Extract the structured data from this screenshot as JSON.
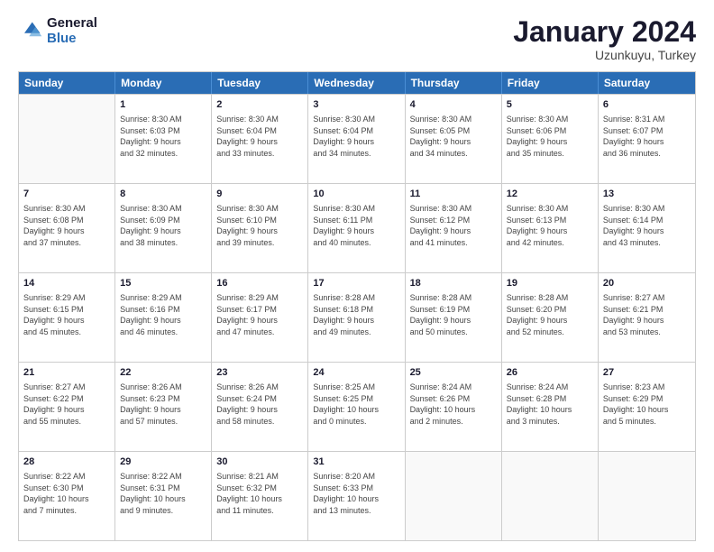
{
  "logo": {
    "general": "General",
    "blue": "Blue"
  },
  "header": {
    "month": "January 2024",
    "location": "Uzunkuyu, Turkey"
  },
  "weekdays": [
    "Sunday",
    "Monday",
    "Tuesday",
    "Wednesday",
    "Thursday",
    "Friday",
    "Saturday"
  ],
  "weeks": [
    [
      {
        "day": "",
        "info": ""
      },
      {
        "day": "1",
        "info": "Sunrise: 8:30 AM\nSunset: 6:03 PM\nDaylight: 9 hours\nand 32 minutes."
      },
      {
        "day": "2",
        "info": "Sunrise: 8:30 AM\nSunset: 6:04 PM\nDaylight: 9 hours\nand 33 minutes."
      },
      {
        "day": "3",
        "info": "Sunrise: 8:30 AM\nSunset: 6:04 PM\nDaylight: 9 hours\nand 34 minutes."
      },
      {
        "day": "4",
        "info": "Sunrise: 8:30 AM\nSunset: 6:05 PM\nDaylight: 9 hours\nand 34 minutes."
      },
      {
        "day": "5",
        "info": "Sunrise: 8:30 AM\nSunset: 6:06 PM\nDaylight: 9 hours\nand 35 minutes."
      },
      {
        "day": "6",
        "info": "Sunrise: 8:31 AM\nSunset: 6:07 PM\nDaylight: 9 hours\nand 36 minutes."
      }
    ],
    [
      {
        "day": "7",
        "info": ""
      },
      {
        "day": "8",
        "info": "Sunrise: 8:30 AM\nSunset: 6:09 PM\nDaylight: 9 hours\nand 38 minutes."
      },
      {
        "day": "9",
        "info": "Sunrise: 8:30 AM\nSunset: 6:10 PM\nDaylight: 9 hours\nand 39 minutes."
      },
      {
        "day": "10",
        "info": "Sunrise: 8:30 AM\nSunset: 6:11 PM\nDaylight: 9 hours\nand 40 minutes."
      },
      {
        "day": "11",
        "info": "Sunrise: 8:30 AM\nSunset: 6:12 PM\nDaylight: 9 hours\nand 41 minutes."
      },
      {
        "day": "12",
        "info": "Sunrise: 8:30 AM\nSunset: 6:13 PM\nDaylight: 9 hours\nand 42 minutes."
      },
      {
        "day": "13",
        "info": "Sunrise: 8:30 AM\nSunset: 6:14 PM\nDaylight: 9 hours\nand 43 minutes."
      }
    ],
    [
      {
        "day": "14",
        "info": ""
      },
      {
        "day": "15",
        "info": "Sunrise: 8:29 AM\nSunset: 6:16 PM\nDaylight: 9 hours\nand 46 minutes."
      },
      {
        "day": "16",
        "info": "Sunrise: 8:29 AM\nSunset: 6:17 PM\nDaylight: 9 hours\nand 47 minutes."
      },
      {
        "day": "17",
        "info": "Sunrise: 8:28 AM\nSunset: 6:18 PM\nDaylight: 9 hours\nand 49 minutes."
      },
      {
        "day": "18",
        "info": "Sunrise: 8:28 AM\nSunset: 6:19 PM\nDaylight: 9 hours\nand 50 minutes."
      },
      {
        "day": "19",
        "info": "Sunrise: 8:28 AM\nSunset: 6:20 PM\nDaylight: 9 hours\nand 52 minutes."
      },
      {
        "day": "20",
        "info": "Sunrise: 8:27 AM\nSunset: 6:21 PM\nDaylight: 9 hours\nand 53 minutes."
      }
    ],
    [
      {
        "day": "21",
        "info": ""
      },
      {
        "day": "22",
        "info": "Sunrise: 8:26 AM\nSunset: 6:23 PM\nDaylight: 9 hours\nand 57 minutes."
      },
      {
        "day": "23",
        "info": "Sunrise: 8:26 AM\nSunset: 6:24 PM\nDaylight: 9 hours\nand 58 minutes."
      },
      {
        "day": "24",
        "info": "Sunrise: 8:25 AM\nSunset: 6:25 PM\nDaylight: 10 hours\nand 0 minutes."
      },
      {
        "day": "25",
        "info": "Sunrise: 8:24 AM\nSunset: 6:26 PM\nDaylight: 10 hours\nand 2 minutes."
      },
      {
        "day": "26",
        "info": "Sunrise: 8:24 AM\nSunset: 6:28 PM\nDaylight: 10 hours\nand 3 minutes."
      },
      {
        "day": "27",
        "info": "Sunrise: 8:23 AM\nSunset: 6:29 PM\nDaylight: 10 hours\nand 5 minutes."
      }
    ],
    [
      {
        "day": "28",
        "info": ""
      },
      {
        "day": "29",
        "info": "Sunrise: 8:22 AM\nSunset: 6:31 PM\nDaylight: 10 hours\nand 9 minutes."
      },
      {
        "day": "30",
        "info": "Sunrise: 8:21 AM\nSunset: 6:32 PM\nDaylight: 10 hours\nand 11 minutes."
      },
      {
        "day": "31",
        "info": "Sunrise: 8:20 AM\nSunset: 6:33 PM\nDaylight: 10 hours\nand 13 minutes."
      },
      {
        "day": "",
        "info": ""
      },
      {
        "day": "",
        "info": ""
      },
      {
        "day": "",
        "info": ""
      }
    ]
  ],
  "week_first_cells": [
    {
      "day": "",
      "info": ""
    },
    {
      "day": "7",
      "sunrise": "Sunrise: 8:30 AM",
      "sunset": "Sunset: 6:08 PM",
      "daylight": "Daylight: 9 hours",
      "minutes": "and 37 minutes."
    },
    {
      "day": "14",
      "sunrise": "Sunrise: 8:29 AM",
      "sunset": "Sunset: 6:15 PM",
      "daylight": "Daylight: 9 hours",
      "minutes": "and 45 minutes."
    },
    {
      "day": "21",
      "sunrise": "Sunrise: 8:27 AM",
      "sunset": "Sunset: 6:22 PM",
      "daylight": "Daylight: 9 hours",
      "minutes": "and 55 minutes."
    },
    {
      "day": "28",
      "sunrise": "Sunrise: 8:22 AM",
      "sunset": "Sunset: 6:30 PM",
      "daylight": "Daylight: 10 hours",
      "minutes": "and 7 minutes."
    }
  ]
}
